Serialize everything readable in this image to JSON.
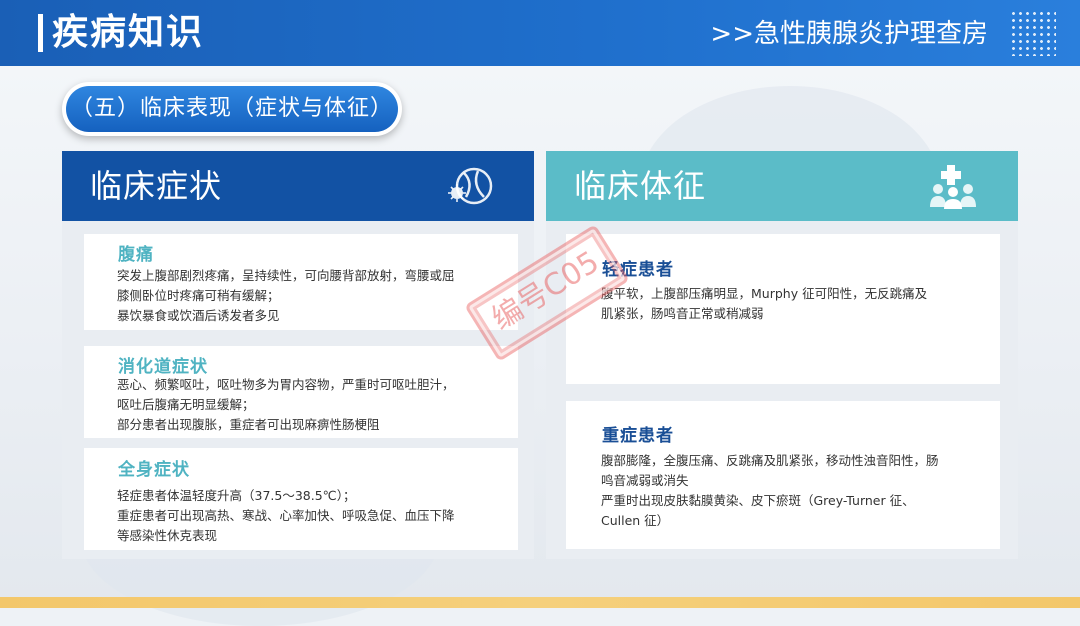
{
  "header": {
    "title": "疾病知识",
    "subtitle": ">>急性胰腺炎护理查房"
  },
  "section": {
    "label": "（五）临床表现（症状与体征）"
  },
  "left_panel": {
    "title": "临床症状",
    "icon": "virus-icon",
    "cards": [
      {
        "title": "腹痛",
        "lines": [
          "突发上腹部剧烈疼痛，呈持续性，可向腰背部放射，弯腰或屈",
          "膝侧卧位时疼痛可稍有缓解；",
          "暴饮暴食或饮酒后诱发者多见"
        ]
      },
      {
        "title": "消化道症状",
        "lines": [
          "恶心、频繁呕吐，呕吐物多为胃内容物，严重时可呕吐胆汁，",
          "呕吐后腹痛无明显缓解；",
          "部分患者出现腹胀，重症者可出现麻痹性肠梗阻"
        ]
      },
      {
        "title": "全身症状",
        "lines": [
          "轻症患者体温轻度升高（37.5～38.5℃）；",
          "重症患者可出现高热、寒战、心率加快、呼吸急促、血压下降",
          "等感染性休克表现"
        ]
      }
    ]
  },
  "right_panel": {
    "title": "临床体征",
    "icon": "medical-team-icon",
    "cards": [
      {
        "title": "轻症患者",
        "lines": [
          "腹平软，上腹部压痛明显，Murphy 征可阳性，无反跳痛及",
          "肌紧张，肠鸣音正常或稍减弱"
        ]
      },
      {
        "title": "重症患者",
        "lines": [
          "腹部膨隆，全腹压痛、反跳痛及肌紧张，移动性浊音阳性，肠",
          "鸣音减弱或消失",
          "严重时出现皮肤黏膜黄染、皮下瘀斑（Grey-Turner 征、",
          "Cullen 征）"
        ]
      }
    ]
  },
  "watermark": "编号C05",
  "colors": {
    "header_blue": "#1a5fb6",
    "left_head": "#1252a4",
    "right_head": "#5bbcc8",
    "teal_title": "#4fb3c2",
    "navy_title": "#1a4f96",
    "bottom_bar": "#f3c76a"
  }
}
